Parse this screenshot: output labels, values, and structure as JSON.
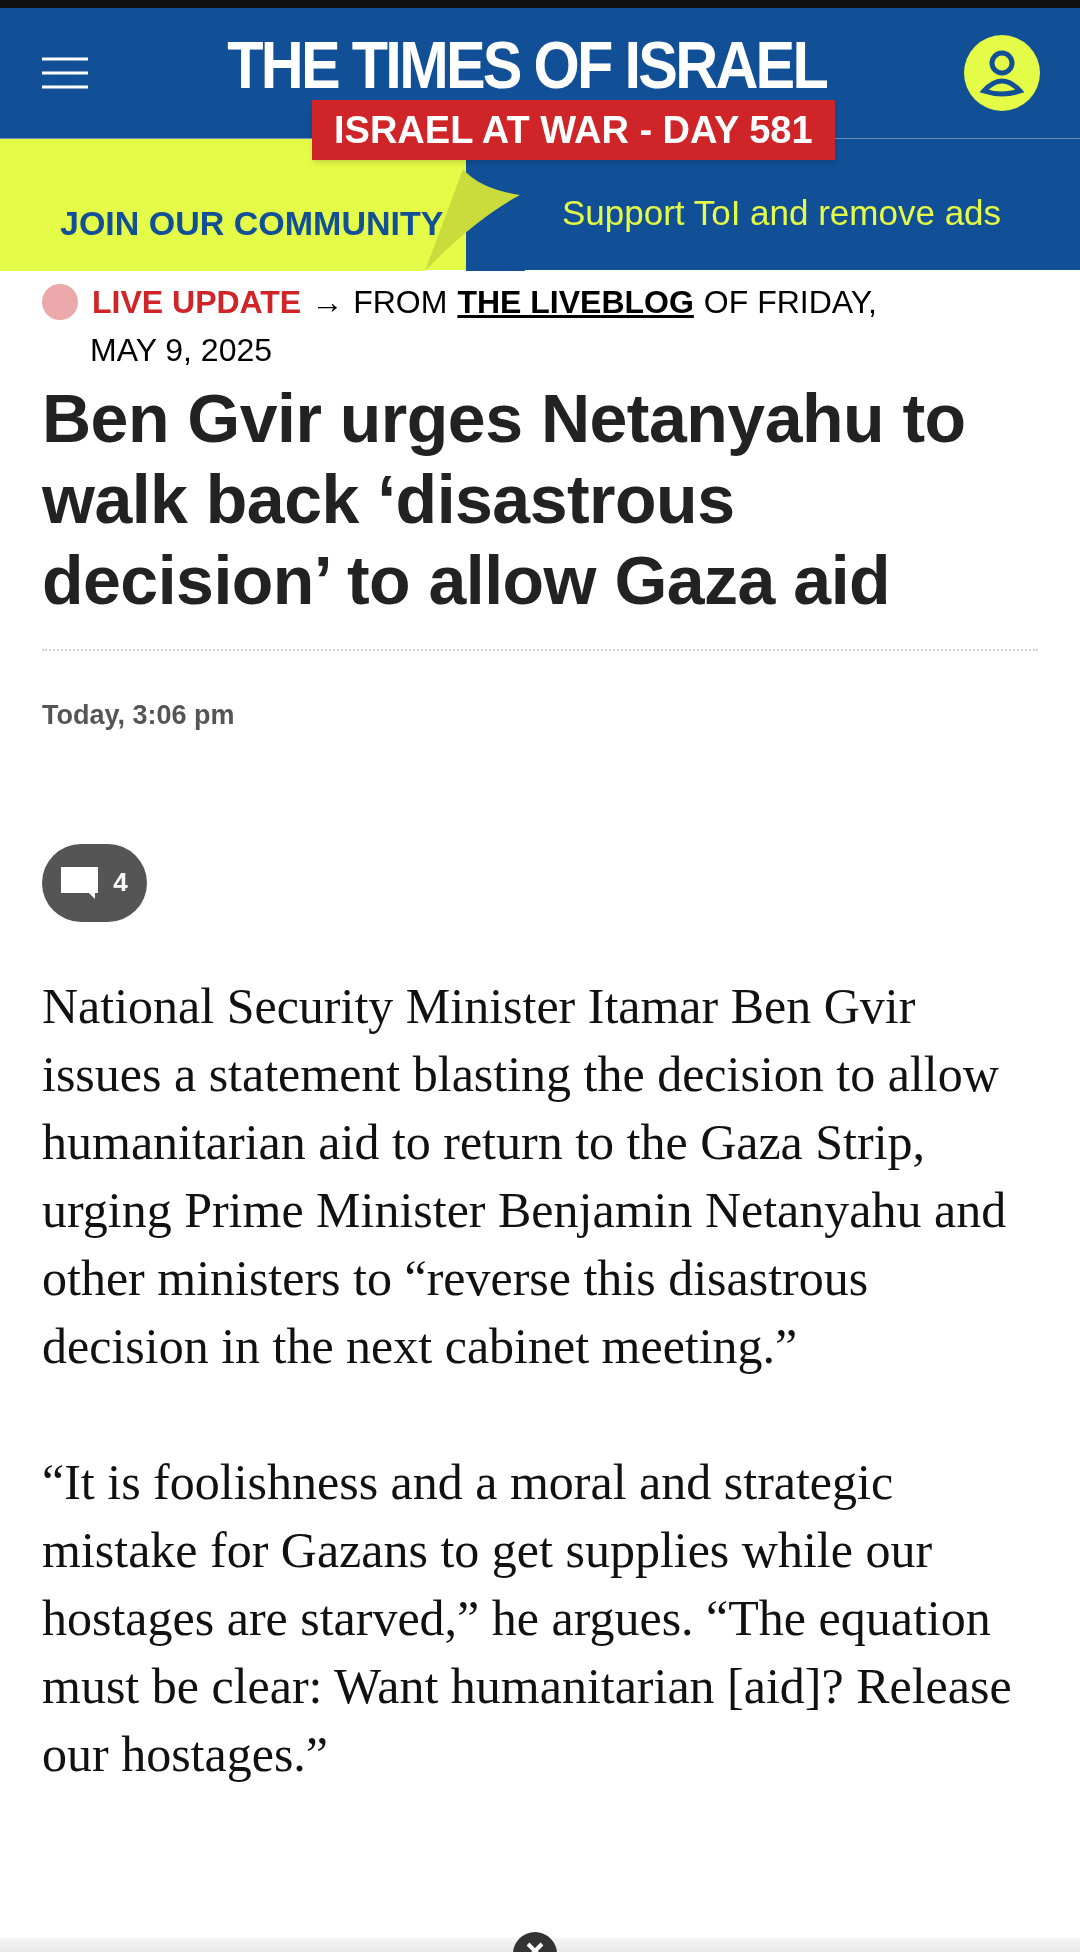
{
  "header": {
    "logo": "THE TIMES OF ISRAEL",
    "war_badge": "ISRAEL AT WAR - DAY 581"
  },
  "promo": {
    "join": "JOIN OUR COMMUNITY",
    "support": "Support ToI and remove ads"
  },
  "kicker": {
    "live": "LIVE UPDATE",
    "arrow": "→",
    "from": "FROM",
    "liveblog": "THE LIVEBLOG",
    "of": "OF FRIDAY,",
    "date": "MAY 9, 2025"
  },
  "headline": "Ben Gvir urges Netanyahu to walk back ‘disastrous decision’ to allow Gaza aid",
  "timestamp": "Today, 3:06 pm",
  "comments": {
    "count": "4"
  },
  "paragraphs": [
    "National Security Minister Itamar Ben Gvir issues a statement blasting the decision to allow humanitarian aid to return to the Gaza Strip, urging Prime Minister Benjamin Netanyahu and other ministers to “reverse this disastrous decision in the next cabinet meeting.”",
    "“It is foolishness and a moral and strategic mistake for Gazans to get supplies while our hostages are starved,” he argues. “The equation must be clear: Want humanitarian [aid]? Release our hostages.”"
  ]
}
